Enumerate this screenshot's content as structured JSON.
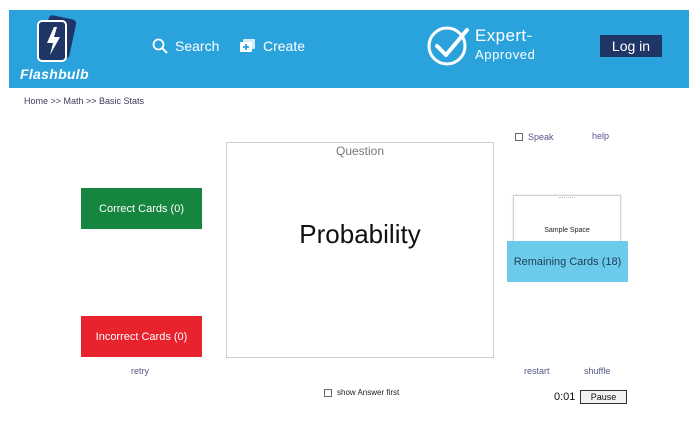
{
  "header": {
    "logo_text": "Flashbulb",
    "nav": {
      "search_label": "Search",
      "create_label": "Create"
    },
    "badge": {
      "line1": "Expert-",
      "line2": "Approved"
    },
    "login_label": "Log in"
  },
  "breadcrumb": "Home >> Math >> Basic Stats",
  "left": {
    "correct_label": "Correct Cards (0)",
    "incorrect_label": "Incorrect Cards (0)",
    "retry_label": "retry"
  },
  "card": {
    "label": "Question",
    "text": "Probability"
  },
  "right": {
    "speak_label": "Speak",
    "help_label": "help",
    "next_card_text": "Sample Space",
    "remaining_label": "Remaining Cards (18)",
    "restart_label": "restart",
    "shuffle_label": "shuffle"
  },
  "footer": {
    "show_answer_label": "show Answer first",
    "timer": "0:01",
    "pause_label": "Pause"
  },
  "colors": {
    "header_bg": "#2aa3dc",
    "login_bg": "#1f3566",
    "correct_bg": "#15853f",
    "incorrect_bg": "#e8232d",
    "remaining_bg": "#6ccbea"
  }
}
